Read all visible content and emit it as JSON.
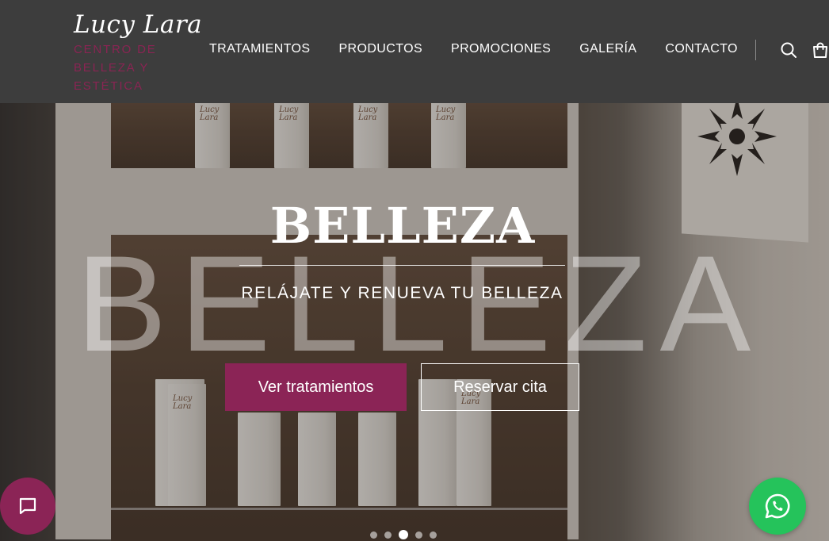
{
  "brand": {
    "name": "Lucy Lara",
    "tagline": "CENTRO DE BELLEZA Y ESTÉTICA",
    "accent_color": "#8b2456"
  },
  "nav": {
    "items": [
      "TRATAMIENTOS",
      "PRODUCTOS",
      "PROMOCIONES",
      "GALERÍA",
      "CONTACTO"
    ],
    "icons": [
      "search-icon",
      "cart-icon"
    ]
  },
  "hero": {
    "background_word": "BELLEZA",
    "title": "BELLEZA",
    "subtitle": "RELÁJATE Y RENUEVA TU BELLEZA",
    "primary_button": "Ver tratamientos",
    "secondary_button": "Reservar cita",
    "product_label": "Lucy Lara"
  },
  "carousel": {
    "total_slides": 5,
    "active_slide": 3
  },
  "floating": {
    "chat_icon": "chat-icon",
    "chat_color": "#8b2456",
    "whatsapp_icon": "whatsapp-icon",
    "whatsapp_color": "#25c35b"
  }
}
